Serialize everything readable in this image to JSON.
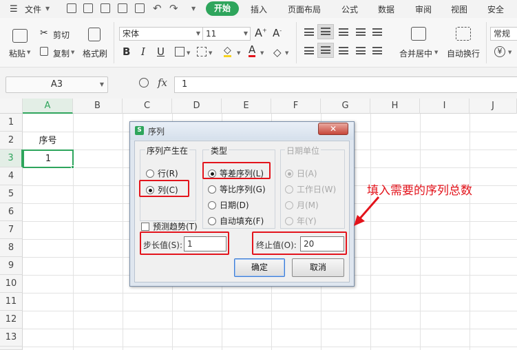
{
  "menubar": {
    "file": "文件",
    "active_tab": "开始",
    "tabs": [
      "插入",
      "页面布局",
      "公式",
      "数据",
      "审阅",
      "视图",
      "安全"
    ]
  },
  "ribbon": {
    "paste": "粘贴",
    "cut": "剪切",
    "copy": "复制",
    "format_painter": "格式刷",
    "font_name": "宋体",
    "font_size": "11",
    "bold": "B",
    "italic": "I",
    "underline": "U",
    "merge_center": "合并居中",
    "wrap_text": "自动换行",
    "number_format": "常规",
    "currency": "¥"
  },
  "formula_bar": {
    "name_box": "A3",
    "fx": "fx",
    "value": "1"
  },
  "grid": {
    "columns": [
      "A",
      "B",
      "C",
      "D",
      "E",
      "F",
      "G",
      "H",
      "I",
      "J"
    ],
    "rows": [
      "1",
      "2",
      "3",
      "4",
      "5",
      "6",
      "7",
      "8",
      "9",
      "10",
      "11",
      "12",
      "13"
    ],
    "a2": "序号",
    "a3": "1",
    "active_cell": "A3"
  },
  "dialog": {
    "title": "序列",
    "series_in": {
      "title": "序列产生在",
      "options": [
        "行(R)",
        "列(C)"
      ],
      "selected": "列(C)"
    },
    "type": {
      "title": "类型",
      "options": [
        "等差序列(L)",
        "等比序列(G)",
        "日期(D)",
        "自动填充(F)"
      ],
      "selected": "等差序列(L)"
    },
    "date_unit": {
      "title": "日期单位",
      "options": [
        "日(A)",
        "工作日(W)",
        "月(M)",
        "年(Y)"
      ],
      "selected": "日(A)"
    },
    "trend": "预测趋势(T)",
    "step_label": "步长值(S):",
    "step_value": "1",
    "stop_label": "终止值(O):",
    "stop_value": "20",
    "ok": "确定",
    "cancel": "取消"
  },
  "annotation": "填入需要的序列总数",
  "colors": {
    "accent_green": "#2ea55c",
    "annotation_red": "#e3131b"
  }
}
